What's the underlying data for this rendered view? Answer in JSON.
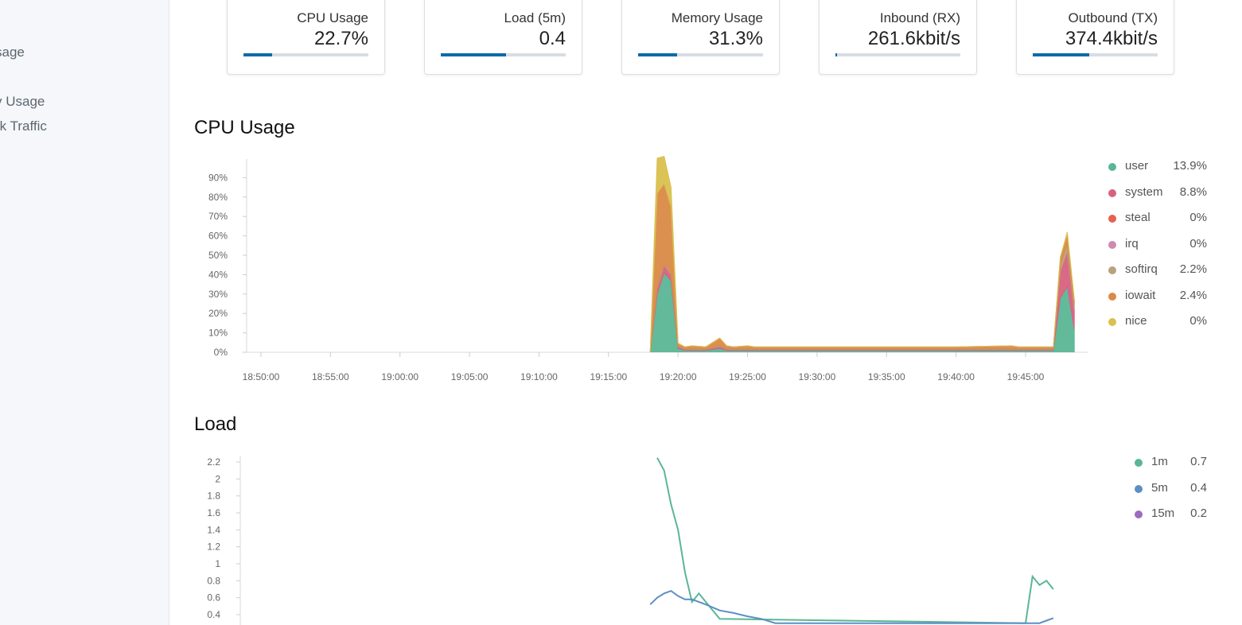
{
  "sidebar": {
    "links": [
      {
        "label": "sage"
      },
      {
        "label": "y Usage"
      },
      {
        "label": "rk Traffic"
      }
    ]
  },
  "stats": [
    {
      "label": "CPU Usage",
      "value": "22.7%",
      "fraction": 0.227
    },
    {
      "label": "Load (5m)",
      "value": "0.4",
      "fraction": 0.52
    },
    {
      "label": "Memory Usage",
      "value": "31.3%",
      "fraction": 0.313
    },
    {
      "label": "Inbound (RX)",
      "value": "261.6kbit/s",
      "fraction": 0.01
    },
    {
      "label": "Outbound (TX)",
      "value": "374.4kbit/s",
      "fraction": 0.45
    }
  ],
  "cpu_section": {
    "title": "CPU Usage"
  },
  "load_section": {
    "title": "Load"
  },
  "colors": {
    "accent": "#0d6aa8",
    "user": "#5ab695",
    "system": "#d8617e",
    "steal": "#e3634f",
    "irq": "#cf8ab2",
    "softirq": "#b9a27e",
    "iowait": "#da8a47",
    "nice": "#d9c04f",
    "load_1m": "#5ab695",
    "load_5m": "#5d8fc2",
    "load_15m": "#9c6bc2"
  },
  "chart_data": [
    {
      "type": "area",
      "stacked": true,
      "x_ticks": [
        "18:50:00",
        "18:55:00",
        "19:00:00",
        "19:05:00",
        "19:10:00",
        "19:15:00",
        "19:20:00",
        "19:25:00",
        "19:30:00",
        "19:35:00",
        "19:40:00",
        "19:45:00"
      ],
      "xlim": [
        "18:49:00",
        "19:49:30"
      ],
      "y_ticks": [
        "0%",
        "10%",
        "20%",
        "30%",
        "40%",
        "50%",
        "60%",
        "70%",
        "80%",
        "90%"
      ],
      "ylim": [
        0,
        100
      ],
      "grid": false,
      "legend_position": "right",
      "legend": [
        {
          "name": "user",
          "value": "13.9%"
        },
        {
          "name": "system",
          "value": "8.8%"
        },
        {
          "name": "steal",
          "value": "0%"
        },
        {
          "name": "irq",
          "value": "0%"
        },
        {
          "name": "softirq",
          "value": "2.2%"
        },
        {
          "name": "iowait",
          "value": "2.4%"
        },
        {
          "name": "nice",
          "value": "0%"
        }
      ],
      "x": [
        "19:18:00",
        "19:18:30",
        "19:19:00",
        "19:19:30",
        "19:20:00",
        "19:20:30",
        "19:21:00",
        "19:22:00",
        "19:23:00",
        "19:23:30",
        "19:24:00",
        "19:25:00",
        "19:25:30",
        "19:26:00",
        "19:27:00",
        "19:30:00",
        "19:35:00",
        "19:40:00",
        "19:44:00",
        "19:44:30",
        "19:45:00",
        "19:46:00",
        "19:47:00",
        "19:47:30",
        "19:48:00",
        "19:48:30"
      ],
      "series": [
        {
          "name": "user",
          "values": [
            0,
            30,
            41,
            37,
            2,
            1,
            1,
            1,
            2,
            1,
            1,
            1,
            1,
            1,
            1,
            1,
            1,
            1,
            1,
            1,
            1,
            1,
            1,
            28,
            34,
            12
          ]
        },
        {
          "name": "system",
          "values": [
            0,
            3,
            4,
            3,
            1,
            0.5,
            0.5,
            0.5,
            1,
            0.5,
            0.5,
            0.5,
            0.5,
            0.5,
            0.5,
            0.5,
            0.5,
            0.5,
            0.5,
            0.5,
            0.5,
            0.5,
            0.5,
            14,
            18,
            10
          ]
        },
        {
          "name": "steal",
          "values": [
            0,
            0,
            0,
            0,
            0,
            0,
            0,
            0,
            0,
            0,
            0,
            0,
            0,
            0,
            0,
            0,
            0,
            0,
            0,
            0,
            0,
            0,
            0,
            0,
            0,
            0
          ]
        },
        {
          "name": "irq",
          "values": [
            0,
            0,
            0,
            0,
            0,
            0,
            0,
            0,
            0,
            0,
            0,
            0,
            0,
            0,
            0,
            0,
            0,
            0,
            0,
            0,
            0,
            0,
            0,
            0,
            0,
            0
          ]
        },
        {
          "name": "softirq",
          "values": [
            0,
            1,
            1,
            1,
            0.5,
            0.3,
            0.3,
            0.3,
            0.3,
            0.3,
            0.3,
            0.3,
            0.3,
            0.3,
            0.3,
            0.3,
            0.3,
            0.3,
            0.3,
            0.3,
            0.3,
            0.3,
            0.3,
            3,
            4,
            2
          ]
        },
        {
          "name": "iowait",
          "values": [
            0,
            48,
            41,
            34,
            1,
            1,
            1.5,
            1,
            4,
            1.5,
            1,
            1.5,
            1,
            1,
            1,
            1,
            1,
            1,
            1.5,
            1,
            1,
            1,
            1,
            4,
            5,
            3
          ]
        },
        {
          "name": "nice",
          "values": [
            0,
            18,
            14,
            10,
            0.2,
            0,
            0,
            0,
            0,
            0,
            0,
            0,
            0,
            0,
            0,
            0,
            0,
            0,
            0,
            0,
            0,
            0,
            0,
            0,
            1,
            0
          ]
        }
      ]
    },
    {
      "type": "line",
      "y_ticks": [
        "0.4",
        "0.6",
        "0.8",
        "1",
        "1.2",
        "1.4",
        "1.6",
        "1.8",
        "2",
        "2.2"
      ],
      "ylim": [
        0.4,
        2.25
      ],
      "xlim": [
        "18:49:00",
        "19:49:30"
      ],
      "grid": false,
      "legend_position": "right",
      "legend": [
        {
          "name": "1m",
          "value": "0.7"
        },
        {
          "name": "5m",
          "value": "0.4"
        },
        {
          "name": "15m",
          "value": "0.2"
        }
      ],
      "series": [
        {
          "name": "1m",
          "x": [
            "19:18:30",
            "19:19:00",
            "19:19:30",
            "19:20:00",
            "19:20:30",
            "19:21:00",
            "19:21:30",
            "19:22:00",
            "19:22:30",
            "19:23:00",
            "19:45:00",
            "19:45:30",
            "19:46:00",
            "19:46:30",
            "19:47:00"
          ],
          "values": [
            2.25,
            2.1,
            1.7,
            1.4,
            0.9,
            0.55,
            0.65,
            0.55,
            0.45,
            0.35,
            0.3,
            0.85,
            0.75,
            0.8,
            0.7
          ]
        },
        {
          "name": "5m",
          "x": [
            "19:18:00",
            "19:18:30",
            "19:19:00",
            "19:19:30",
            "19:20:00",
            "19:20:30",
            "19:21:00",
            "19:22:00",
            "19:23:00",
            "19:24:00",
            "19:25:00",
            "19:26:00",
            "19:27:00",
            "19:46:00",
            "19:46:30",
            "19:47:00"
          ],
          "values": [
            0.52,
            0.6,
            0.65,
            0.68,
            0.62,
            0.58,
            0.58,
            0.52,
            0.45,
            0.42,
            0.38,
            0.35,
            0.3,
            0.3,
            0.33,
            0.36
          ]
        }
      ]
    }
  ]
}
